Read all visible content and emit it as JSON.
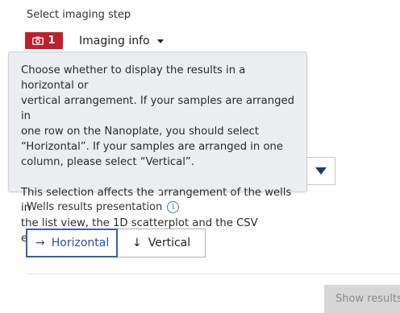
{
  "imaging_step": {
    "label": "Select imaging step",
    "step_number": "1",
    "step_icon": "camera-icon",
    "selected_option": "Imaging info",
    "accent_color": "#c0202e"
  },
  "tooltip": {
    "paragraph_1": "Choose whether to display the results in a horizontal or\nvertical arrangement. If your samples are arranged in\none row on the Nanoplate, you should select\n“Horizontal”. If your samples are arranged in one\ncolumn, please select “Vertical”.",
    "paragraph_2": "This selection affects the arrangement of the wells in\nthe list view, the 1D scatterplot and the CSV export."
  },
  "wells_presentation": {
    "label": "Wells results presentation",
    "info_icon": "info-icon",
    "options": [
      {
        "arrow": "→",
        "label": "Horizontal",
        "selected": true
      },
      {
        "arrow": "↓",
        "label": "Vertical",
        "selected": false
      }
    ]
  },
  "footer": {
    "show_results_label": "Show results"
  }
}
